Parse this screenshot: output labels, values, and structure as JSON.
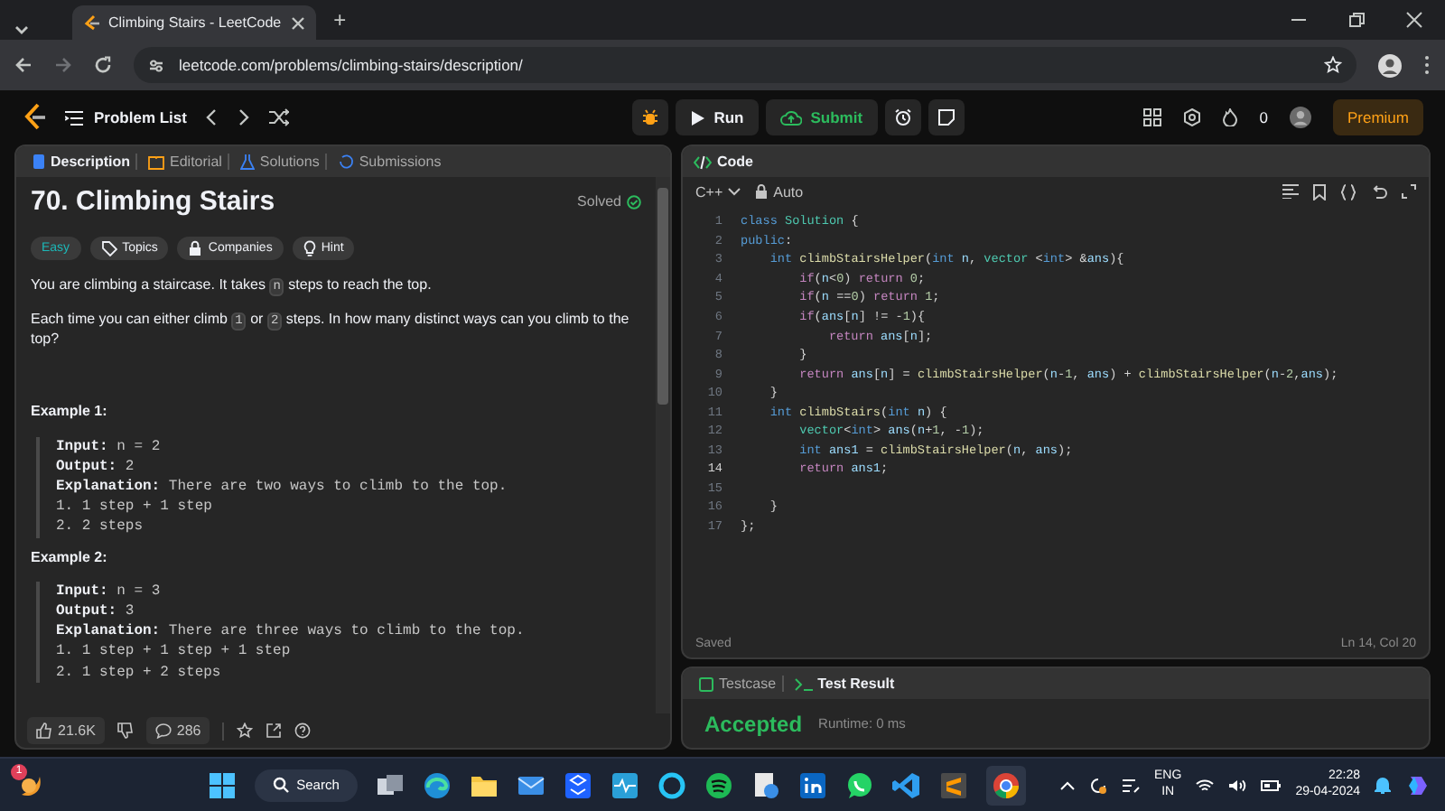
{
  "browser": {
    "tab_title": "Climbing Stairs - LeetCode",
    "new_tab": "+",
    "url": "leetcode.com/problems/climbing-stairs/description/"
  },
  "nav": {
    "problem_list": "Problem List",
    "run": "Run",
    "submit": "Submit",
    "streak": "0",
    "premium": "Premium"
  },
  "left_tabs": [
    {
      "label": "Description",
      "selected": true
    },
    {
      "label": "Editorial",
      "selected": false
    },
    {
      "label": "Solutions",
      "selected": false
    },
    {
      "label": "Submissions",
      "selected": false
    }
  ],
  "problem": {
    "title": "70. Climbing Stairs",
    "status": "Solved",
    "tags": [
      {
        "label": "Easy",
        "kind": "difficulty"
      },
      {
        "label": "Topics",
        "kind": "topics"
      },
      {
        "label": "Companies",
        "kind": "companies"
      },
      {
        "label": "Hint",
        "kind": "hint"
      }
    ],
    "paragraphs": [
      [
        {
          "text": "You are climbing a staircase. It takes "
        },
        {
          "code": "n"
        },
        {
          "text": " steps to reach the top."
        }
      ],
      [
        {
          "text": "Each time you can either climb "
        },
        {
          "code": "1"
        },
        {
          "text": " or "
        },
        {
          "code": "2"
        },
        {
          "text": " steps. In how many distinct ways can you climb to the top?"
        }
      ]
    ],
    "examples": [
      {
        "title": "Example 1:",
        "fields": [
          {
            "label": "Input:",
            "value": "n = 2"
          },
          {
            "label": "Output:",
            "value": "2"
          },
          {
            "label": "Explanation:",
            "value": "There are two ways to climb to the top."
          }
        ],
        "steps": [
          "1. 1 step + 1 step",
          "2. 2 steps"
        ]
      },
      {
        "title": "Example 2:",
        "fields": [
          {
            "label": "Input:",
            "value": "n = 3"
          },
          {
            "label": "Output:",
            "value": "3"
          },
          {
            "label": "Explanation:",
            "value": "There are three ways to climb to the top."
          }
        ],
        "steps": [
          "1. 1 step + 1 step + 1 step",
          "2. 1 step + 2 steps"
        ]
      }
    ],
    "likes": "21.6K",
    "comments": "286"
  },
  "code": {
    "header": "Code",
    "language": "C++",
    "mode": "Auto",
    "lines": [
      {
        "num": "1",
        "current": false,
        "code": [
          {
            "kind": "keyword",
            "text": "class "
          },
          {
            "kind": "type",
            "text": "Solution"
          },
          {
            "kind": "plain",
            "text": " {"
          }
        ]
      },
      {
        "num": "2",
        "current": false,
        "code": [
          {
            "kind": "keyword",
            "text": "public"
          },
          {
            "kind": "plain",
            "text": ":"
          }
        ]
      },
      {
        "num": "3",
        "current": false,
        "code": [
          {
            "kind": "keyword",
            "text": "    int "
          },
          {
            "kind": "function",
            "text": "climbStairsHelper"
          },
          {
            "kind": "plain",
            "text": "("
          },
          {
            "kind": "keyword",
            "text": "int "
          },
          {
            "kind": "variable",
            "text": "n"
          },
          {
            "kind": "plain",
            "text": ", "
          },
          {
            "kind": "type",
            "text": "vector "
          },
          {
            "kind": "plain",
            "text": "<"
          },
          {
            "kind": "keyword",
            "text": "int"
          },
          {
            "kind": "plain",
            "text": "> &"
          },
          {
            "kind": "variable",
            "text": "ans"
          },
          {
            "kind": "plain",
            "text": "){"
          }
        ]
      },
      {
        "num": "4",
        "current": false,
        "code": [
          {
            "kind": "control",
            "text": "        if"
          },
          {
            "kind": "plain",
            "text": "("
          },
          {
            "kind": "variable",
            "text": "n"
          },
          {
            "kind": "plain",
            "text": "<"
          },
          {
            "kind": "number",
            "text": "0"
          },
          {
            "kind": "plain",
            "text": ") "
          },
          {
            "kind": "control",
            "text": "return "
          },
          {
            "kind": "number",
            "text": "0"
          },
          {
            "kind": "plain",
            "text": ";"
          }
        ]
      },
      {
        "num": "5",
        "current": false,
        "code": [
          {
            "kind": "control",
            "text": "        if"
          },
          {
            "kind": "plain",
            "text": "("
          },
          {
            "kind": "variable",
            "text": "n"
          },
          {
            "kind": "plain",
            "text": " =="
          },
          {
            "kind": "number",
            "text": "0"
          },
          {
            "kind": "plain",
            "text": ") "
          },
          {
            "kind": "control",
            "text": "return "
          },
          {
            "kind": "number",
            "text": "1"
          },
          {
            "kind": "plain",
            "text": ";"
          }
        ]
      },
      {
        "num": "6",
        "current": false,
        "code": [
          {
            "kind": "control",
            "text": "        if"
          },
          {
            "kind": "plain",
            "text": "("
          },
          {
            "kind": "variable",
            "text": "ans"
          },
          {
            "kind": "plain",
            "text": "["
          },
          {
            "kind": "variable",
            "text": "n"
          },
          {
            "kind": "plain",
            "text": "] != -"
          },
          {
            "kind": "number",
            "text": "1"
          },
          {
            "kind": "plain",
            "text": "){"
          }
        ]
      },
      {
        "num": "7",
        "current": false,
        "code": [
          {
            "kind": "control",
            "text": "            return "
          },
          {
            "kind": "variable",
            "text": "ans"
          },
          {
            "kind": "plain",
            "text": "["
          },
          {
            "kind": "variable",
            "text": "n"
          },
          {
            "kind": "plain",
            "text": "];"
          }
        ]
      },
      {
        "num": "8",
        "current": false,
        "code": [
          {
            "kind": "plain",
            "text": "        }"
          }
        ]
      },
      {
        "num": "9",
        "current": false,
        "code": [
          {
            "kind": "control",
            "text": "        return "
          },
          {
            "kind": "variable",
            "text": "ans"
          },
          {
            "kind": "plain",
            "text": "["
          },
          {
            "kind": "variable",
            "text": "n"
          },
          {
            "kind": "plain",
            "text": "] = "
          },
          {
            "kind": "function",
            "text": "climbStairsHelper"
          },
          {
            "kind": "plain",
            "text": "("
          },
          {
            "kind": "variable",
            "text": "n"
          },
          {
            "kind": "plain",
            "text": "-"
          },
          {
            "kind": "number",
            "text": "1"
          },
          {
            "kind": "plain",
            "text": ", "
          },
          {
            "kind": "variable",
            "text": "ans"
          },
          {
            "kind": "plain",
            "text": ") + "
          },
          {
            "kind": "function",
            "text": "climbStairsHelper"
          },
          {
            "kind": "plain",
            "text": "("
          },
          {
            "kind": "variable",
            "text": "n"
          },
          {
            "kind": "plain",
            "text": "-"
          },
          {
            "kind": "number",
            "text": "2"
          },
          {
            "kind": "plain",
            "text": ","
          },
          {
            "kind": "variable",
            "text": "ans"
          },
          {
            "kind": "plain",
            "text": ");"
          }
        ]
      },
      {
        "num": "10",
        "current": false,
        "code": [
          {
            "kind": "plain",
            "text": "    }"
          }
        ]
      },
      {
        "num": "11",
        "current": false,
        "code": [
          {
            "kind": "keyword",
            "text": "    int "
          },
          {
            "kind": "function",
            "text": "climbStairs"
          },
          {
            "kind": "plain",
            "text": "("
          },
          {
            "kind": "keyword",
            "text": "int "
          },
          {
            "kind": "variable",
            "text": "n"
          },
          {
            "kind": "plain",
            "text": ") {"
          }
        ]
      },
      {
        "num": "12",
        "current": false,
        "code": [
          {
            "kind": "type",
            "text": "        vector"
          },
          {
            "kind": "plain",
            "text": "<"
          },
          {
            "kind": "keyword",
            "text": "int"
          },
          {
            "kind": "plain",
            "text": "> "
          },
          {
            "kind": "variable",
            "text": "ans"
          },
          {
            "kind": "plain",
            "text": "("
          },
          {
            "kind": "variable",
            "text": "n"
          },
          {
            "kind": "plain",
            "text": "+"
          },
          {
            "kind": "number",
            "text": "1"
          },
          {
            "kind": "plain",
            "text": ", -"
          },
          {
            "kind": "number",
            "text": "1"
          },
          {
            "kind": "plain",
            "text": ");"
          }
        ]
      },
      {
        "num": "13",
        "current": false,
        "code": [
          {
            "kind": "keyword",
            "text": "        int "
          },
          {
            "kind": "variable",
            "text": "ans1"
          },
          {
            "kind": "plain",
            "text": " = "
          },
          {
            "kind": "function",
            "text": "climbStairsHelper"
          },
          {
            "kind": "plain",
            "text": "("
          },
          {
            "kind": "variable",
            "text": "n"
          },
          {
            "kind": "plain",
            "text": ", "
          },
          {
            "kind": "variable",
            "text": "ans"
          },
          {
            "kind": "plain",
            "text": ");"
          }
        ]
      },
      {
        "num": "14",
        "current": true,
        "code": [
          {
            "kind": "control",
            "text": "        return "
          },
          {
            "kind": "variable",
            "text": "ans1"
          },
          {
            "kind": "plain",
            "text": ";"
          }
        ]
      },
      {
        "num": "15",
        "current": false
      },
      {
        "num": "16",
        "current": false,
        "code": [
          {
            "kind": "plain",
            "text": "    }"
          }
        ]
      },
      {
        "num": "17",
        "current": false,
        "code": [
          {
            "kind": "plain",
            "text": "};"
          }
        ]
      }
    ],
    "save_status": "Saved",
    "cursor": "Ln 14, Col 20"
  },
  "result_tabs": [
    {
      "label": "Testcase",
      "selected": false
    },
    {
      "label": "Test Result",
      "selected": true
    }
  ],
  "result": {
    "verdict": "Accepted",
    "runtime": "Runtime: 0 ms"
  },
  "taskbar": {
    "weather_badge": "1",
    "search": "Search",
    "lang": "ENG",
    "region": "IN",
    "time": "22:28",
    "date": "29-04-2024"
  }
}
